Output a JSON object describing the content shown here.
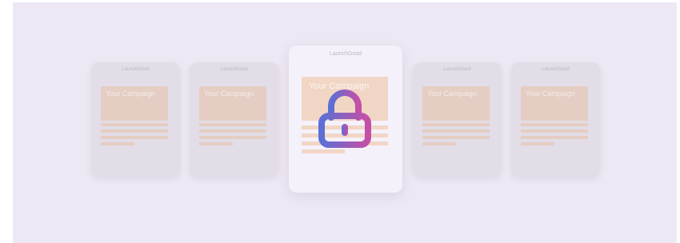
{
  "cards": [
    {
      "brand": "LaunchGood",
      "hero_text": "Your Campaign"
    },
    {
      "brand": "LaunchGood",
      "hero_text": "Your Campaign"
    },
    {
      "brand": "LaunchGood",
      "hero_text": "Your Campaign"
    },
    {
      "brand": "LaunchGood",
      "hero_text": "Your Campaign"
    },
    {
      "brand": "LaunchGood",
      "hero_text": "Your Campaign"
    }
  ],
  "lock": {
    "icon": "lock-icon",
    "colors": [
      "#5b6fd6",
      "#c54fa6"
    ]
  }
}
